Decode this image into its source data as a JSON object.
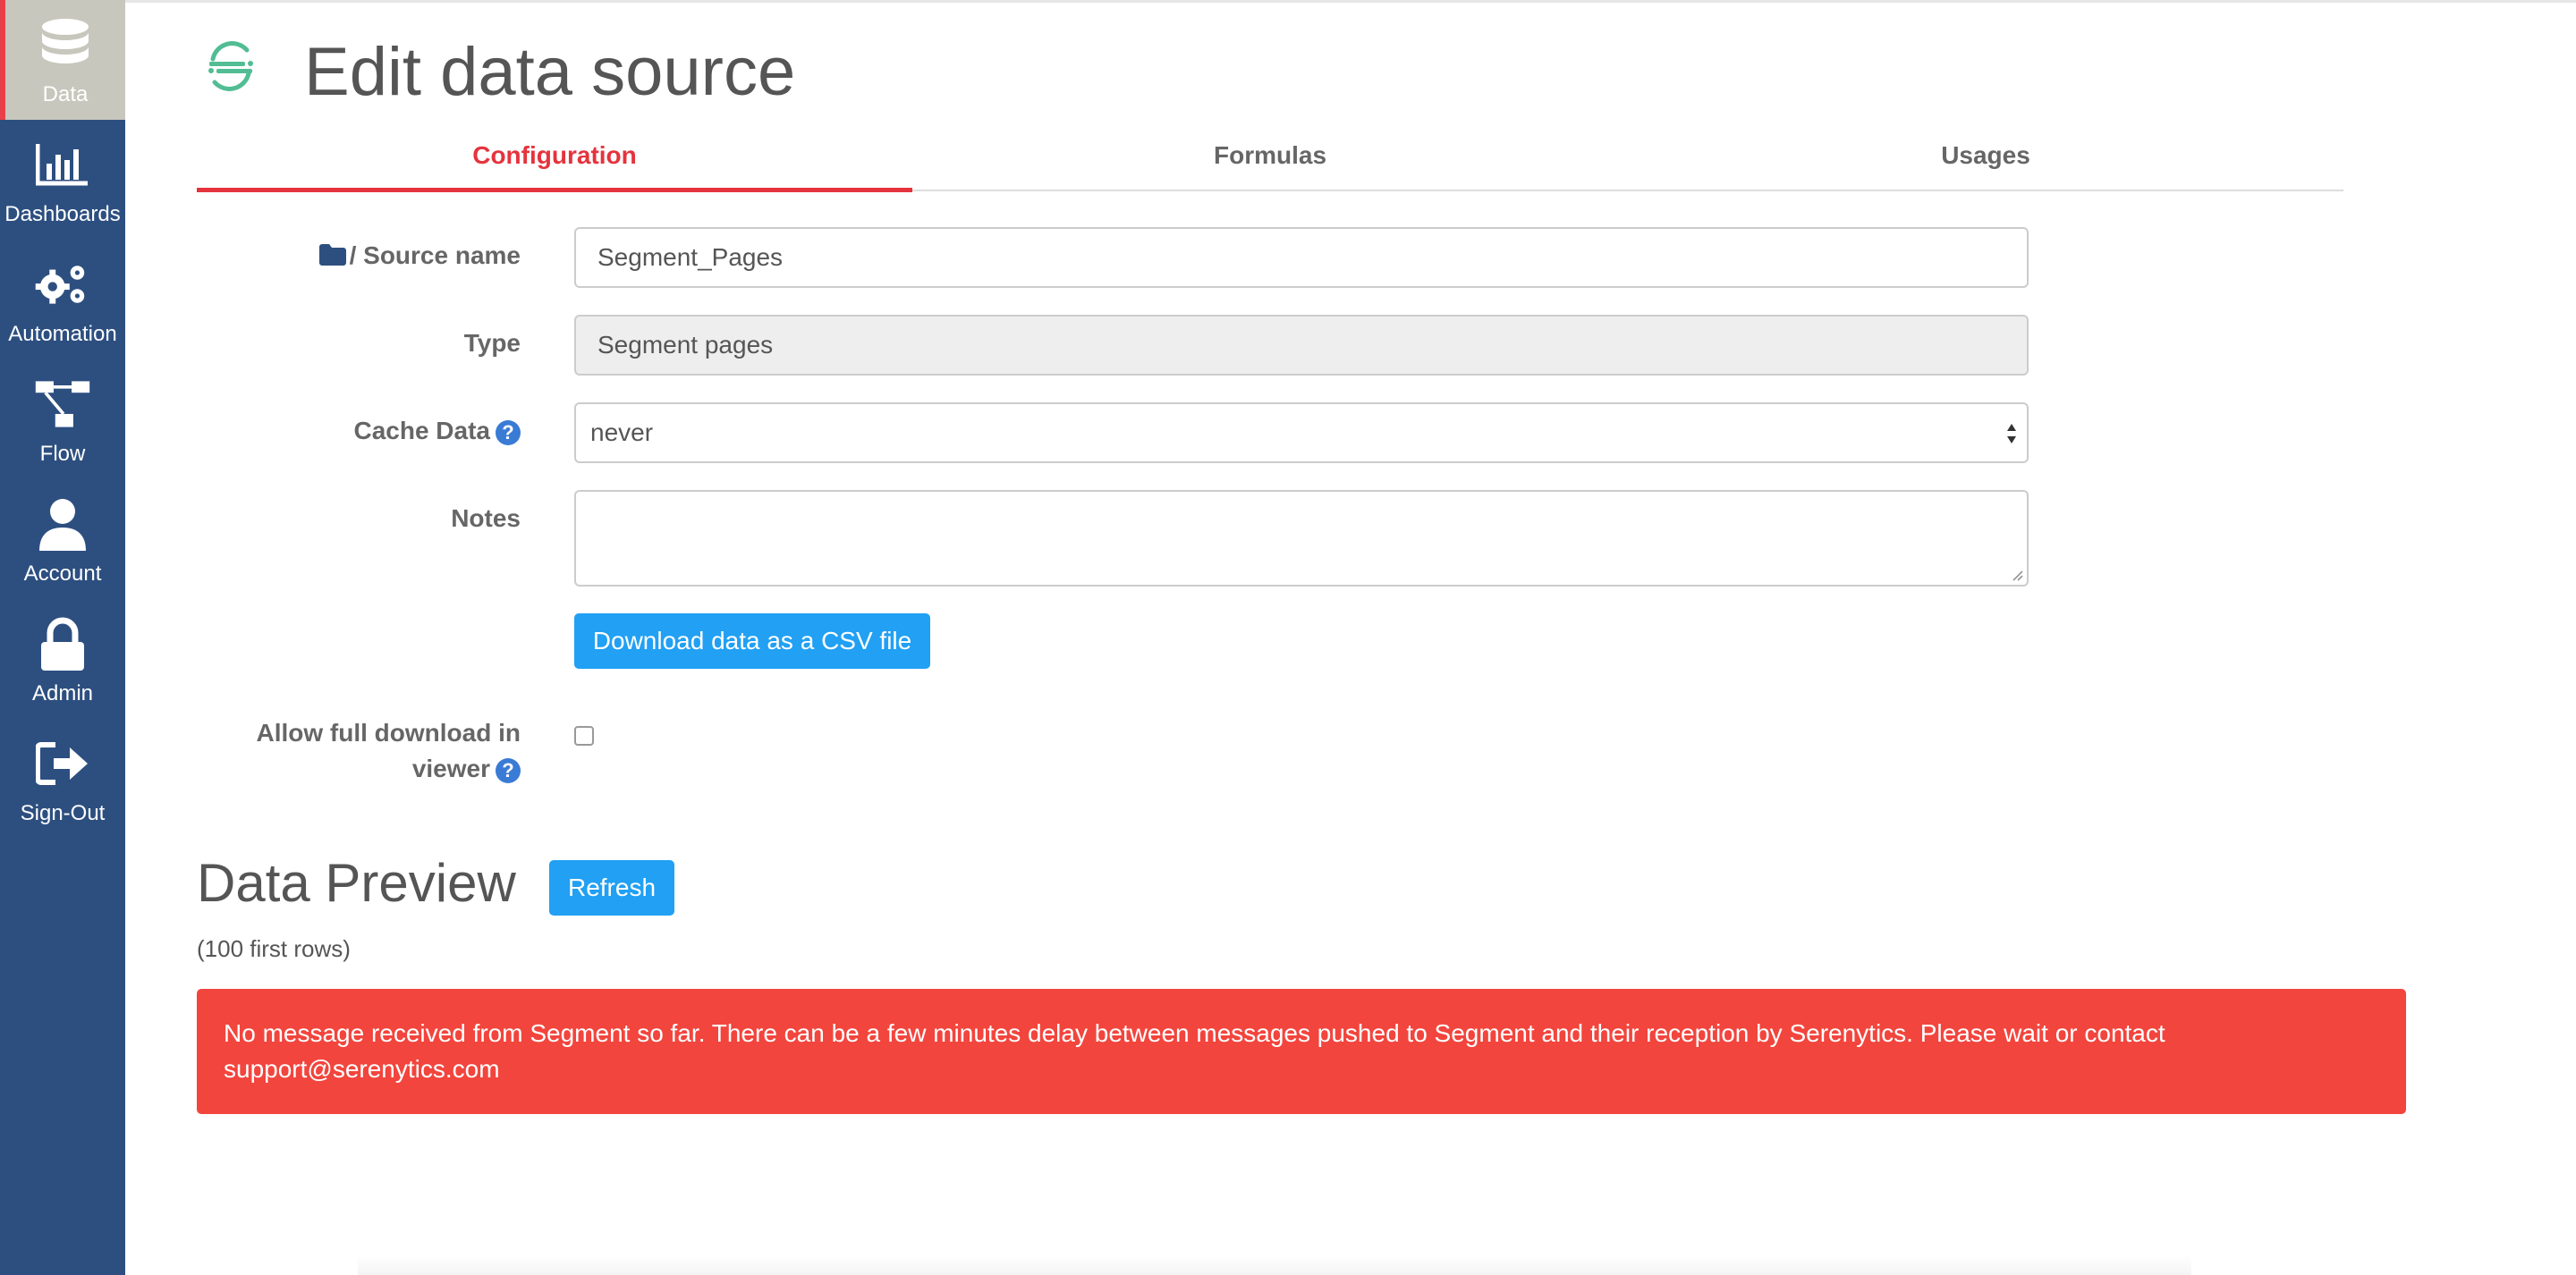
{
  "sidebar": {
    "items": [
      {
        "label": "Data",
        "icon": "database-icon",
        "active": true
      },
      {
        "label": "Dashboards",
        "icon": "bar-chart-icon",
        "active": false
      },
      {
        "label": "Automation",
        "icon": "gears-icon",
        "active": false
      },
      {
        "label": "Flow",
        "icon": "flow-icon",
        "active": false
      },
      {
        "label": "Account",
        "icon": "user-icon",
        "active": false
      },
      {
        "label": "Admin",
        "icon": "lock-icon",
        "active": false
      },
      {
        "label": "Sign-Out",
        "icon": "sign-out-icon",
        "active": false
      }
    ]
  },
  "header": {
    "title": "Edit data source",
    "logo_icon": "segment-logo-icon"
  },
  "tabs": [
    {
      "label": "Configuration",
      "active": true
    },
    {
      "label": "Formulas",
      "active": false
    },
    {
      "label": "Usages",
      "active": false
    }
  ],
  "form": {
    "source_name_label": "/ Source name",
    "source_name_value": "Segment_Pages",
    "type_label": "Type",
    "type_value": "Segment pages",
    "cache_label": "Cache Data",
    "cache_value": "never",
    "notes_label": "Notes",
    "notes_value": "",
    "download_button": "Download data as a CSV file",
    "allow_download_label_line1": "Allow full download in",
    "allow_download_label_line2": "viewer",
    "allow_download_checked": false
  },
  "preview": {
    "title": "Data Preview",
    "refresh_button": "Refresh",
    "subtitle": "(100 first rows)",
    "alert_line1": "No message received from Segment so far. There can be a few minutes delay between messages pushed to Segment and their reception by Serenytics. Please wait or contact",
    "alert_line2": "support@serenytics.com"
  },
  "colors": {
    "sidebar_bg": "#2d4f80",
    "active_tab": "#e5333d",
    "button_blue": "#21a0f4",
    "alert_red": "#f2453d"
  }
}
